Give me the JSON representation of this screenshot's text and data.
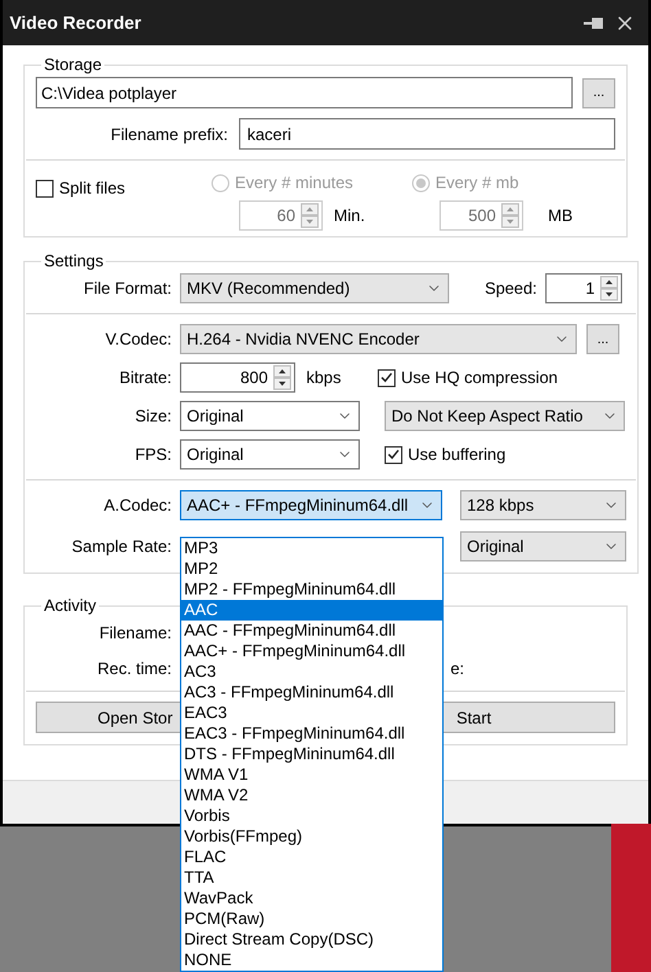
{
  "window": {
    "title": "Video Recorder"
  },
  "storage": {
    "title": "Storage",
    "path": "C:\\Videa potplayer",
    "browse_button": "...",
    "prefix_label": "Filename prefix:",
    "prefix": "kaceri",
    "split_files": {
      "label": "Split files",
      "checked": false
    },
    "split_options": [
      {
        "label": "Every # minutes",
        "selected": false,
        "value": "60",
        "unit": "Min."
      },
      {
        "label": "Every # mb",
        "selected": true,
        "value": "500",
        "unit": "MB"
      }
    ]
  },
  "settings": {
    "title": "Settings",
    "file_format": {
      "label": "File Format:",
      "value": "MKV (Recommended)"
    },
    "speed": {
      "label": "Speed:",
      "value": "1"
    },
    "video_codec": {
      "label": "V.Codec:",
      "value": "H.264 - Nvidia NVENC Encoder",
      "button": "..."
    },
    "bitrate": {
      "label": "Bitrate:",
      "value": "800",
      "unit": "kbps"
    },
    "hq_compression": {
      "label": "Use HQ compression",
      "checked": true
    },
    "size": {
      "label": "Size:",
      "value": "Original"
    },
    "aspect": {
      "value": "Do Not Keep Aspect Ratio"
    },
    "fps": {
      "label": "FPS:",
      "value": "Original"
    },
    "buffering": {
      "label": "Use buffering",
      "checked": true
    },
    "audio_codec": {
      "label": "A.Codec:",
      "value": "AAC+ - FFmpegMininum64.dll",
      "expanded": true
    },
    "audio_bitrate": {
      "value": "128 kbps"
    },
    "sample_rate": {
      "label": "Sample Rate:",
      "value": "Original"
    }
  },
  "activity": {
    "title": "Activity",
    "filename_label": "Filename:",
    "rec_time_label": "Rec. time:",
    "column_3": "e:",
    "buttons": [
      "Open Stor",
      "Start"
    ]
  },
  "dropdown": {
    "items": [
      {
        "label": "MP3",
        "selected": false
      },
      {
        "label": "MP2",
        "selected": false
      },
      {
        "label": "MP2 - FFmpegMininum64.dll",
        "selected": false
      },
      {
        "label": "AAC",
        "selected": true
      },
      {
        "label": "AAC - FFmpegMininum64.dll",
        "selected": false
      },
      {
        "label": "AAC+ - FFmpegMininum64.dll",
        "selected": false
      },
      {
        "label": "AC3",
        "selected": false
      },
      {
        "label": "AC3 - FFmpegMininum64.dll",
        "selected": false
      },
      {
        "label": "EAC3",
        "selected": false
      },
      {
        "label": "EAC3 - FFmpegMininum64.dll",
        "selected": false
      },
      {
        "label": "DTS - FFmpegMininum64.dll",
        "selected": false
      },
      {
        "label": "WMA V1",
        "selected": false
      },
      {
        "label": "WMA V2",
        "selected": false
      },
      {
        "label": "Vorbis",
        "selected": false
      },
      {
        "label": "Vorbis(FFmpeg)",
        "selected": false
      },
      {
        "label": "FLAC",
        "selected": false
      },
      {
        "label": "TTA",
        "selected": false
      },
      {
        "label": "WavPack",
        "selected": false
      },
      {
        "label": "PCM(Raw)",
        "selected": false
      },
      {
        "label": "Direct Stream Copy(DSC)",
        "selected": false
      },
      {
        "label": "NONE",
        "selected": false
      }
    ]
  }
}
